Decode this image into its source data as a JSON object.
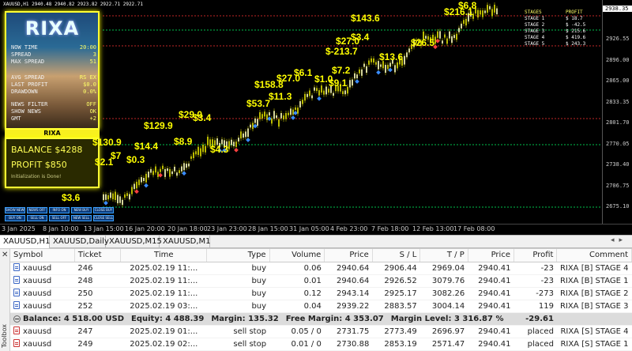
{
  "chart": {
    "header": "XAUUSD,H1  2940.48  2940.82  2923.82  2922.71  2922.71",
    "price_labels": [
      "2938.35",
      "2926.55",
      "2896.00",
      "2865.00",
      "2833.35",
      "2801.70",
      "2770.05",
      "2738.40",
      "2706.75",
      "2675.10",
      "2643.45"
    ],
    "current_price": "2938.35",
    "time_labels": [
      "3 Jan 2025",
      "8 Jan 10:00",
      "13 Jan 15:00",
      "16 Jan 20:00",
      "20 Jan 18:00",
      "23 Jan 23:00",
      "28 Jan 15:00",
      "31 Jan 05:00",
      "4 Feb 23:00",
      "7 Feb 18:00",
      "12 Feb 13:00",
      "17 Feb 08:00"
    ],
    "profit_labels": [
      "$3.6",
      "$2.1",
      "$130.9",
      "$7",
      "$0.3",
      "$14.4",
      "$129.9",
      "$8.9",
      "$29.0",
      "$3.4",
      "$4.3",
      "$53.7",
      "$158.8",
      "$11.3",
      "$27.0",
      "$6.1",
      "$1.0",
      "$9.1",
      "$7.2",
      "$27.0",
      "$3.4",
      "$-213.7",
      "$13.6",
      "$143.6",
      "$26.5",
      "$216.1",
      "$6.8"
    ],
    "buttons": [
      "SHOW NEWS",
      "NEWS OFF",
      "INFO ON",
      "NEW BUY",
      "CLOSE BUY",
      "BUY ON",
      "SELL ON",
      "SELL OFF",
      "NEW SELL",
      "CLOSE SELL"
    ]
  },
  "panel": {
    "title": "RIXA",
    "rows": [
      {
        "k": "NOW TIME",
        "v": "20:00"
      },
      {
        "k": "SPREAD",
        "v": "3"
      },
      {
        "k": "MAX SPREAD",
        "v": "51"
      },
      {
        "k": "AVG SPREAD",
        "v": "RS EX"
      },
      {
        "k": "LAST PROFIT",
        "v": "$0.0"
      },
      {
        "k": "DRAWDOWN",
        "v": "0.0%"
      },
      {
        "k": "NEWS FILTER",
        "v": "OFF"
      },
      {
        "k": "SHOW NEWS",
        "v": "OK"
      },
      {
        "k": "GMT",
        "v": "+2"
      }
    ],
    "band": "RIXA",
    "balance": "BALANCE  $4288",
    "profit": "PROFIT   $850",
    "init": "Initialization is Done!"
  },
  "stages": {
    "head_left": "STAGES",
    "head_right": "PROFIT",
    "rows": [
      {
        "name": "STAGE 1",
        "val": "$ 18.7"
      },
      {
        "name": "STAGE 2",
        "val": "$ -42.5"
      },
      {
        "name": "STAGE 3",
        "val": "$ 215.6"
      },
      {
        "name": "STAGE 4",
        "val": "$ 419.6"
      },
      {
        "name": "STAGE 5",
        "val": "$ 243.3"
      }
    ]
  },
  "tabs": [
    "XAUUSD,H1",
    "XAUUSD,Daily",
    "XAUUSD,M15",
    "XAUUSD,M1"
  ],
  "terminal": {
    "side_label": "Toolbox",
    "columns": [
      "Symbol",
      "Ticket",
      "Time",
      "Type",
      "Volume",
      "Price",
      "S / L",
      "T / P",
      "Price",
      "Profit",
      "Comment"
    ],
    "positions": [
      [
        "xauusd",
        "246",
        "2025.02.19 11:...",
        "buy",
        "0.06",
        "2940.64",
        "2906.44",
        "2969.04",
        "2940.41",
        "-23",
        "RIXA [B] STAGE 4"
      ],
      [
        "xauusd",
        "248",
        "2025.02.19 11:...",
        "buy",
        "0.01",
        "2940.64",
        "2926.52",
        "3079.76",
        "2940.41",
        "-23",
        "RIXA [B] STAGE 1"
      ],
      [
        "xauusd",
        "250",
        "2025.02.19 11:...",
        "buy",
        "0.12",
        "2943.14",
        "2925.17",
        "3082.26",
        "2940.41",
        "-273",
        "RIXA [B] STAGE 2"
      ],
      [
        "xauusd",
        "252",
        "2025.02.19 03:...",
        "buy",
        "0.04",
        "2939.22",
        "2883.57",
        "3004.14",
        "2940.41",
        "119",
        "RIXA [B] STAGE 3"
      ]
    ],
    "summary": {
      "balance": "Balance: 4 518.00 USD",
      "equity": "Equity: 4 488.39",
      "margin": "Margin: 135.32",
      "free_margin": "Free Margin: 4 353.07",
      "margin_level": "Margin Level: 3 316.87 %",
      "profit": "-29.61"
    },
    "orders": [
      [
        "xauusd",
        "247",
        "2025.02.19 01:...",
        "sell stop",
        "0.05 / 0",
        "2731.75",
        "2773.49",
        "2696.97",
        "2940.41",
        "placed",
        "RIXA [S] STAGE 4"
      ],
      [
        "xauusd",
        "249",
        "2025.02.19 02:...",
        "sell stop",
        "0.01 / 0",
        "2730.88",
        "2853.19",
        "2571.47",
        "2940.41",
        "placed",
        "RIXA [S] STAGE 1"
      ]
    ]
  }
}
